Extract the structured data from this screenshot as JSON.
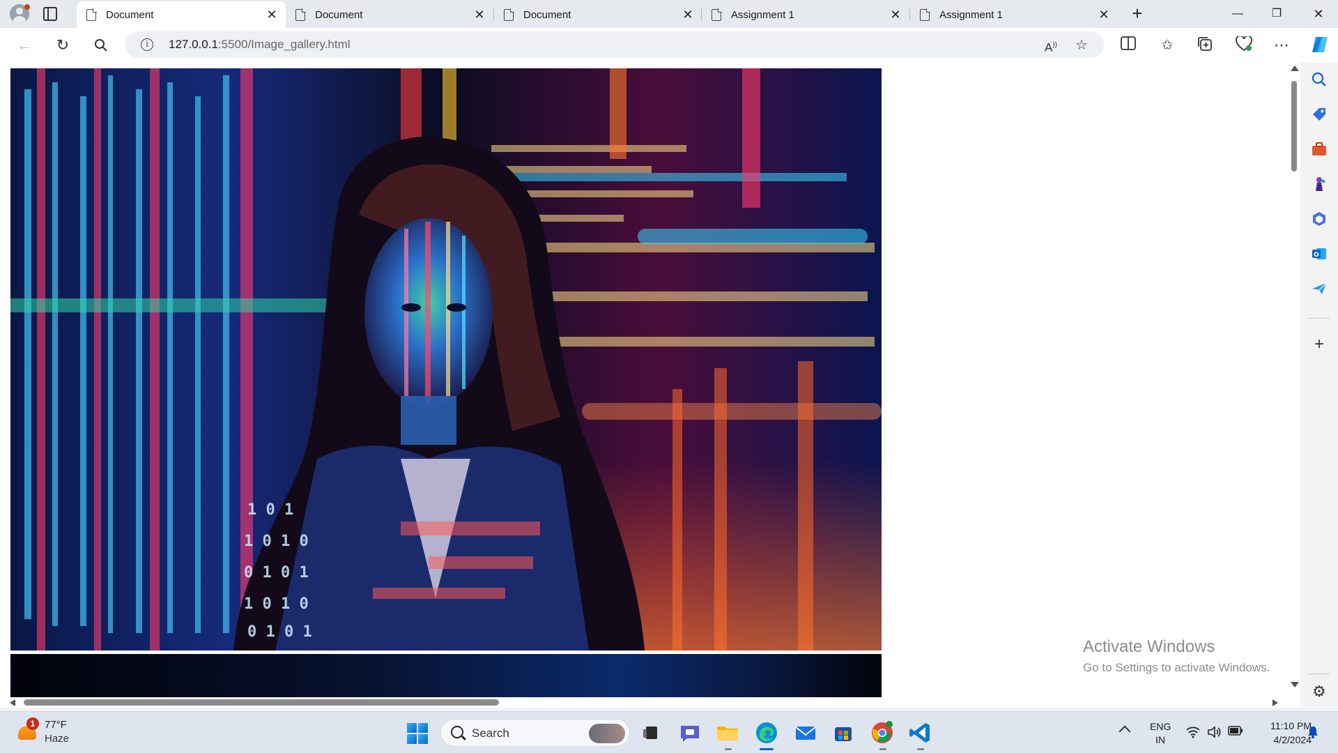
{
  "browser": {
    "tabs": [
      {
        "title": "Document",
        "active": true
      },
      {
        "title": "Document",
        "active": false
      },
      {
        "title": "Document",
        "active": false
      },
      {
        "title": "Assignment 1",
        "active": false
      },
      {
        "title": "Assignment 1",
        "active": false
      }
    ],
    "address": {
      "host": "127.0.0.1",
      "rest": ":5500/Image_gallery.html"
    }
  },
  "page": {
    "image_description_icon": "photo-person-with-code-projection"
  },
  "watermark": {
    "title": "Activate Windows",
    "subtitle": "Go to Settings to activate Windows."
  },
  "taskbar": {
    "weather": {
      "temp": "77°F",
      "condition": "Haze",
      "badge": "1"
    },
    "search_label": "Search",
    "lang_top": "ENG",
    "lang_bottom": "IN",
    "time": "11:10 PM",
    "date": "4/2/2024"
  },
  "colors": {
    "accent": "#0067c0",
    "tabstrip": "#e6e9ee",
    "taskbar": "#dfe5ef"
  }
}
